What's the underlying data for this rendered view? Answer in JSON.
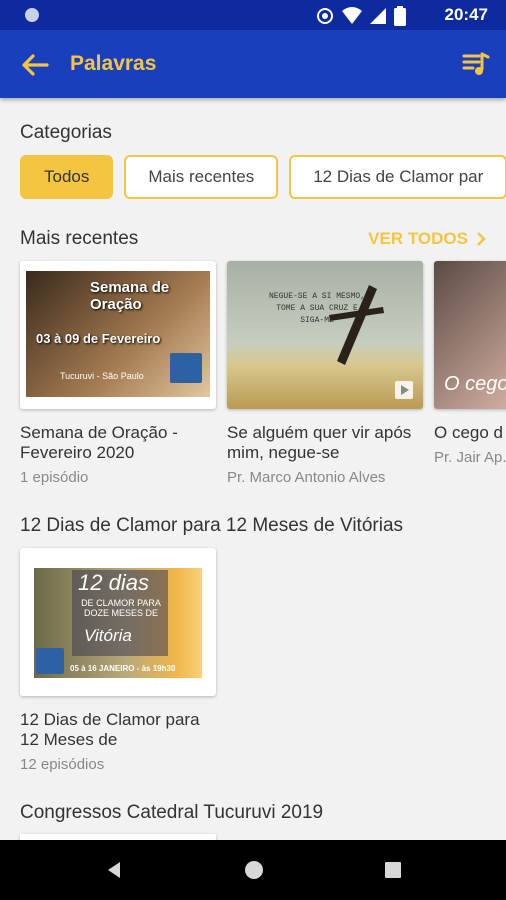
{
  "status": {
    "time": "20:47"
  },
  "appbar": {
    "title": "Palavras"
  },
  "categories": {
    "title": "Categorias",
    "chips": [
      "Todos",
      "Mais recentes",
      "12 Dias de Clamor par"
    ]
  },
  "recent": {
    "title": "Mais recentes",
    "see_all": "VER TODOS",
    "items": [
      {
        "title": "Semana de Oração - Fevereiro 2020",
        "subtitle": "1 episódio",
        "thumb_title": "Semana de Oração",
        "thumb_date": "03 à 09 de Fevereiro",
        "thumb_place": "Tucuruvi - São Paulo"
      },
      {
        "title": "Se alguém quer vir após mim, negue-se",
        "subtitle": "Pr. Marco Antonio Alves",
        "thumb_text": "NEGUE-SE A SI MESMO, TOME A SUA CRUZ E SIGA-ME"
      },
      {
        "title": "O cego d",
        "subtitle": "Pr. Jair Ap.",
        "thumb_text": "O cego"
      }
    ]
  },
  "clamor": {
    "title": "12 Dias de Clamor para 12 Meses de Vitórias",
    "item": {
      "title": "12 Dias de Clamor para 12 Meses de",
      "subtitle": "12 episódios",
      "thumb_big": "12 dias",
      "thumb_mid": "DE CLAMOR PARA DOZE MESES DE",
      "thumb_vit": "Vitória",
      "thumb_date": "05 à 16 JANEIRO - às 19h30"
    }
  },
  "congressos": {
    "title": "Congressos Catedral Tucuruvi 2019"
  },
  "colors": {
    "primary": "#1a3fbc",
    "accent": "#f5c542",
    "status": "#0d2b9e"
  }
}
